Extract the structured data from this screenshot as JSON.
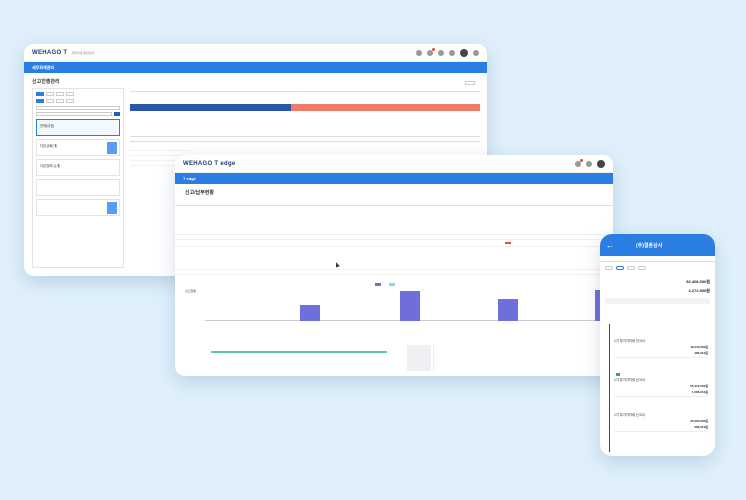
{
  "w1": {
    "logo": "WEHAGO T",
    "logo_sub": "세무회계 통합관리",
    "brand": "세무회계관리",
    "nav": [
      "",
      "",
      "",
      "",
      "",
      "",
      "",
      "",
      ""
    ],
    "title": "신고진행관리",
    "top_button": "",
    "left_chips": [
      "",
      "",
      "",
      ""
    ],
    "left_chips2": [
      "",
      "",
      "",
      ""
    ],
    "select": "",
    "search_placeholder": "",
    "search_button": "",
    "hint": "",
    "cards": [
      {
        "title": "전체(대표)",
        "sub": ""
      },
      {
        "title": "다온상회(개)",
        "sub": ""
      },
      {
        "title": "다온컴퍼니(개)",
        "sub": ""
      },
      {
        "title": "",
        "sub": ""
      },
      {
        "title": "",
        "sub": ""
      }
    ],
    "tabs": [
      "",
      "",
      "",
      "",
      "",
      ""
    ],
    "row_label": "",
    "progress_label": "",
    "table_headers": [
      "",
      "",
      "",
      "",
      "",
      ""
    ],
    "list": [
      "",
      "",
      "",
      ""
    ]
  },
  "w2": {
    "logo": "WEHAGO T edge",
    "brand": "T edge",
    "title": "신고/납부현황",
    "tabs": [
      "",
      ""
    ],
    "col_headers": [
      "",
      "",
      "",
      "",
      ""
    ],
    "rows": [
      {
        "name": "",
        "tag": "",
        "vals": [
          "",
          "",
          "",
          ""
        ]
      },
      {
        "name": "",
        "tag": "",
        "vals": [
          "",
          "",
          "",
          ""
        ]
      },
      {
        "name": "",
        "tag": "",
        "vals": [
          "",
          "",
          "",
          ""
        ]
      },
      {
        "name": "",
        "tag": "",
        "vals": [
          "",
          "",
          "",
          ""
        ]
      },
      {
        "name": "",
        "tag": "",
        "vals": [
          "",
          "",
          "",
          ""
        ]
      },
      {
        "name": "",
        "tag": "",
        "vals": [
          "",
          "",
          "",
          ""
        ]
      }
    ],
    "chart_label": "신고현황",
    "gantt_label": "",
    "legend": [
      "",
      ""
    ]
  },
  "w3": {
    "title": "(주)결혼상사",
    "tabs": [
      "",
      "",
      "",
      "",
      ""
    ],
    "pills": [
      "",
      "",
      "",
      ""
    ],
    "section_title": "",
    "year": "",
    "kv1_label": "",
    "kv1_value": "52,408,000원",
    "kv2_label": "",
    "kv2_value": "2,272,900원",
    "timeline_head": "",
    "events": [
      {
        "date": "",
        "status": "",
        "name": "1기 부가가치세 신고서",
        "link": "",
        "r1l": "",
        "r1v": "18,110,000원",
        "r2l": "",
        "r2v": "486,210원"
      },
      {
        "date": "",
        "status": "",
        "name": "1기 부가가치세 신고서",
        "link": "",
        "r1l": "",
        "r1v": "55,410,000원",
        "r2l": "",
        "r2v": "1,586,210원"
      },
      {
        "date": "",
        "status": "",
        "name": "1기 부가가치세 신고서",
        "link": "",
        "r1l": "",
        "r1v": "25,460,000원",
        "r2l": "",
        "r2v": "586,210원"
      }
    ]
  },
  "colors": {
    "accent": "#2a7de1",
    "progress_done": "#2a55a8",
    "progress_rest": "#f07b68",
    "bar": "#6f6fdc",
    "gantt": "#5cc9a0",
    "background": "#dff0fb"
  },
  "progress": {
    "done_fraction": 0.46
  },
  "bars": [
    0.5,
    0.95,
    0.7,
    0.98
  ]
}
